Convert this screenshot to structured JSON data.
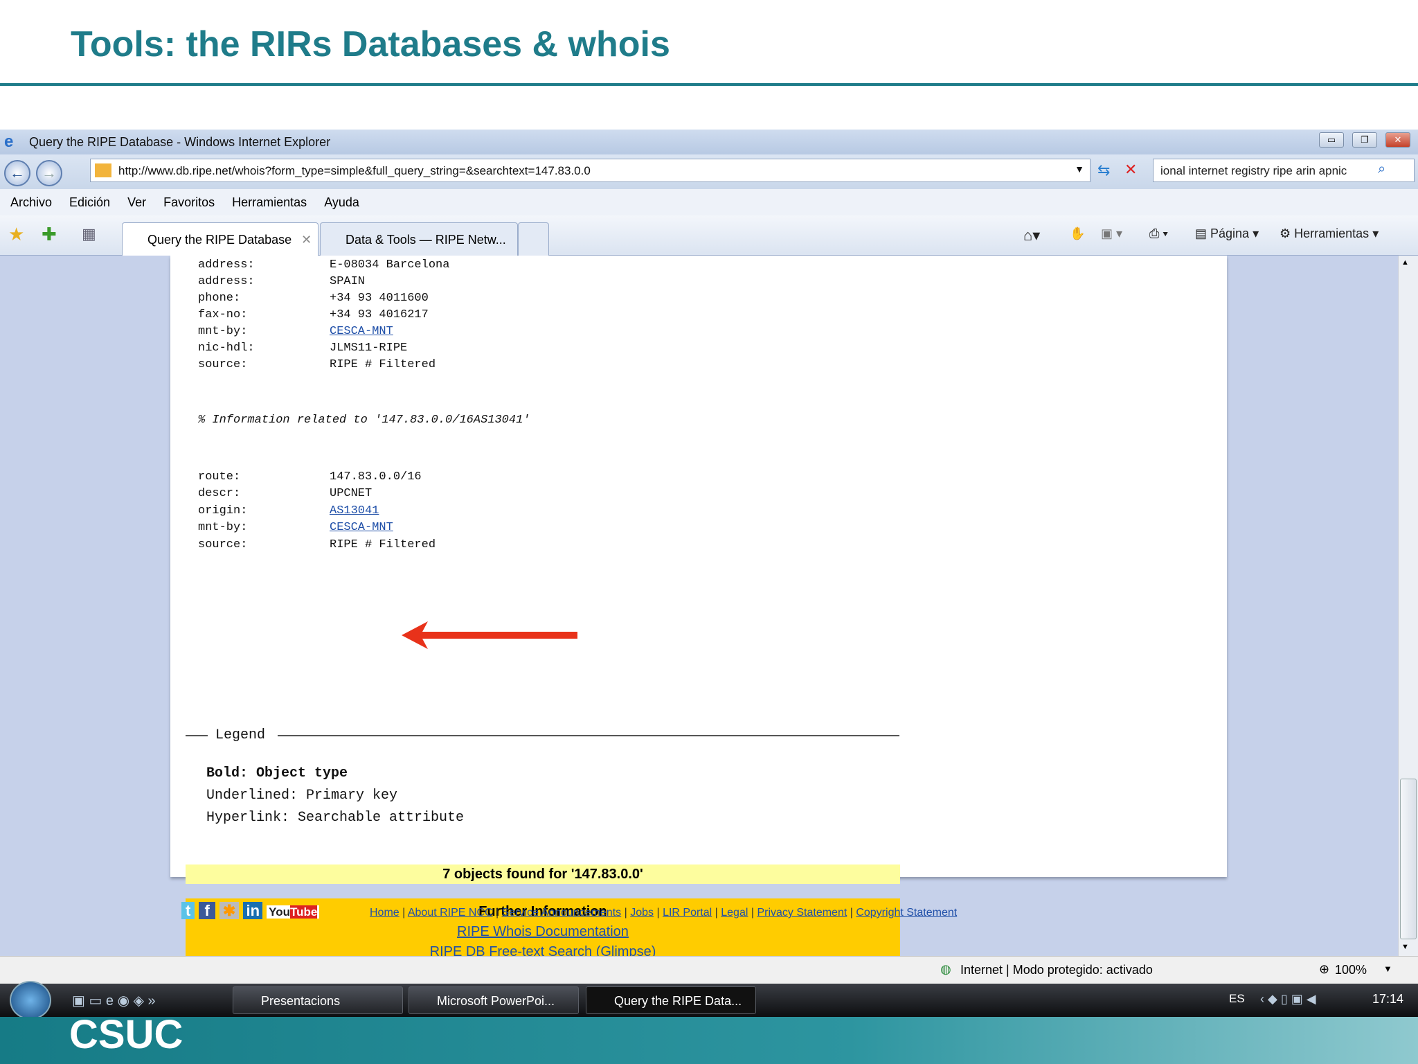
{
  "slide": {
    "title": "Tools: the RIRs Databases & whois",
    "logo": "CSUC"
  },
  "window": {
    "title": "Query the RIPE Database - Windows Internet Explorer",
    "url": "http://www.db.ripe.net/whois?form_type=simple&full_query_string=&searchtext=147.83.0.0",
    "search_text": "ional internet registry ripe arin apnic"
  },
  "menu": [
    "Archivo",
    "Edición",
    "Ver",
    "Favoritos",
    "Herramientas",
    "Ayuda"
  ],
  "tabs": [
    {
      "label": "Query the RIPE Database"
    },
    {
      "label": "Data & Tools — RIPE Netw..."
    }
  ],
  "commands": {
    "page": "Página",
    "tools": "Herramientas"
  },
  "person_rows": [
    {
      "k": "address:",
      "v": "E-08034 Barcelona"
    },
    {
      "k": "address:",
      "v": "SPAIN"
    },
    {
      "k": "phone:",
      "v": "+34 93 4011600"
    },
    {
      "k": "fax-no:",
      "v": "+34 93 4016217"
    },
    {
      "k": "mnt-by:",
      "v": "CESCA-MNT",
      "link": true
    },
    {
      "k": "nic-hdl:",
      "v": "JLMS11-RIPE"
    },
    {
      "k": "source:",
      "v": "RIPE # Filtered"
    }
  ],
  "info_line": "% Information related to '147.83.0.0/16AS13041'",
  "route_rows": [
    {
      "k": "route:",
      "v": "147.83.0.0/16"
    },
    {
      "k": "descr:",
      "v": "UPCNET"
    },
    {
      "k": "origin:",
      "v": "AS13041",
      "link": true
    },
    {
      "k": "mnt-by:",
      "v": "CESCA-MNT",
      "link": true
    },
    {
      "k": "source:",
      "v": "RIPE # Filtered"
    }
  ],
  "legend": {
    "title": "Legend",
    "bold": "Bold: Object type",
    "underlined": "Underlined: Primary key",
    "hyperlink": "Hyperlink: Searchable attribute"
  },
  "found": "7 objects found for '147.83.0.0'",
  "further": {
    "title": "Further Information",
    "links": [
      "RIPE Whois Documentation",
      "RIPE DB Free-text Search (Glimpse)"
    ]
  },
  "footer_links": [
    "Home",
    "About RIPE NCC",
    "Service Announcements",
    "Jobs",
    "LIR Portal",
    "Legal",
    "Privacy Statement",
    "Copyright Statement"
  ],
  "social": [
    "twitter-icon",
    "facebook-icon",
    "rss-icon",
    "linkedin-icon",
    "youtube-icon"
  ],
  "status": {
    "zone": "Internet | Modo protegido: activado",
    "zoom": "100%"
  },
  "taskbar": {
    "items": [
      "Presentacions",
      "Microsoft PowerPoi...",
      "Query the RIPE Data..."
    ],
    "lang": "ES",
    "time": "17:14"
  }
}
